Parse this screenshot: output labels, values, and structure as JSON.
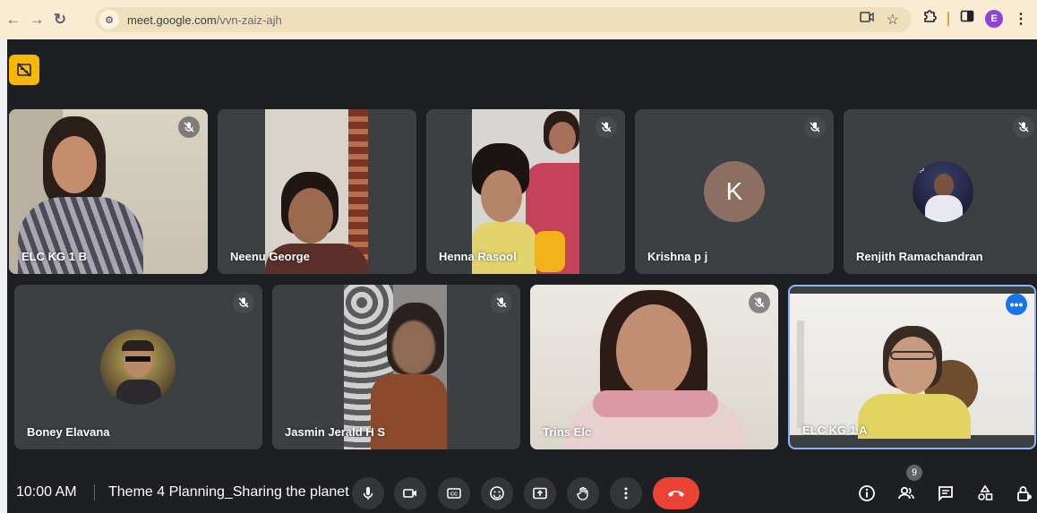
{
  "browser": {
    "url_host": "meet.google.com",
    "url_path": "/vvn-zaiz-ajh",
    "profile_initial": "E",
    "icons": [
      "back-icon",
      "forward-icon",
      "reload-icon",
      "site-info-icon",
      "camera-icon",
      "bookmark-star-icon",
      "extensions-icon",
      "sidepanel-icon",
      "profile-avatar",
      "kebab-menu-icon"
    ]
  },
  "colors": {
    "meet_background": "#1e1f22",
    "tile_background": "#3c4043",
    "hangup_red": "#ea4335",
    "active_speaker_blue": "#8ab4f8",
    "badge_yellow": "#f6b800"
  },
  "participants": [
    {
      "name": "ELC KG 1 B",
      "muted": true,
      "video": true
    },
    {
      "name": "Neenu George",
      "muted": false,
      "video": true
    },
    {
      "name": "Henna Rasool",
      "muted": true,
      "video": true
    },
    {
      "name": "Krishna p j",
      "muted": true,
      "video": false,
      "avatar_letter": "K",
      "avatar_color": "#8d6e63"
    },
    {
      "name": "Renjith Ramachandran",
      "muted": true,
      "video": false
    },
    {
      "name": "Boney Elavana",
      "muted": true,
      "video": false
    },
    {
      "name": "Jasmin Jerald H S",
      "muted": true,
      "video": true
    },
    {
      "name": "Trins Elc",
      "muted": true,
      "video": true
    },
    {
      "name": "ELC KG 1 A",
      "muted": false,
      "video": true,
      "active": true
    }
  ],
  "bottom_bar": {
    "time": "10:00 AM",
    "meeting_title": "Theme 4 Planning_Sharing the planet",
    "participant_count": "9"
  }
}
